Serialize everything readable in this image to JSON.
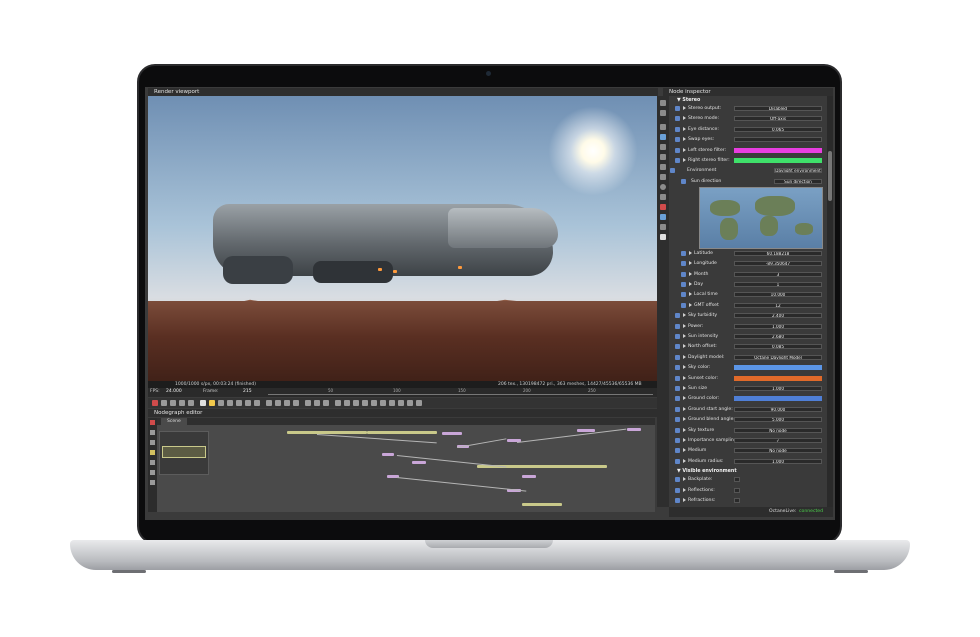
{
  "viewport": {
    "title": "Render viewport",
    "status_left": "1000/1000 s/px, 00:03:24 (finished)",
    "status_right": "206 tex., 130198472 pri., 363 meshes, 14427/45536/65536 MB",
    "timeline_ticks": [
      "50",
      "100",
      "150",
      "200",
      "250"
    ],
    "fps_label": "FPS:",
    "fps_value": "24.000",
    "frame_label": "Frame:",
    "frame_value": "215"
  },
  "nodegraph": {
    "title": "Nodegraph editor",
    "tab": "Scene"
  },
  "inspector": {
    "title": "Node inspector",
    "stereo_section": "Stereo",
    "stereo": [
      {
        "label": "Stereo output:",
        "value": "Disabled"
      },
      {
        "label": "Stereo mode:",
        "value": "Off-axis"
      },
      {
        "label": "Eye distance:",
        "value": "0.065"
      },
      {
        "label": "Swap eyes:",
        "value": ""
      },
      {
        "label": "Left stereo filter:",
        "swatch": "#e83ee0"
      },
      {
        "label": "Right stereo filter:",
        "swatch": "#3fe06a"
      }
    ],
    "environment_label": "Environment",
    "environment_value": "Daylight environment",
    "sun_direction_label": "Sun direction",
    "sun_direction_value": "Sun direction",
    "sun_params": [
      {
        "label": "Latitude",
        "value": "60.188218"
      },
      {
        "label": "Longitude",
        "value": "-89.350647"
      },
      {
        "label": "Month",
        "value": "3"
      },
      {
        "label": "Day",
        "value": "1"
      },
      {
        "label": "Local time",
        "value": "10.000"
      },
      {
        "label": "GMT offset",
        "value": "12"
      }
    ],
    "env_params": [
      {
        "label": "Sky turbidity",
        "value": "2.400"
      },
      {
        "label": "Power:",
        "value": "1.000"
      },
      {
        "label": "Sun intensity",
        "value": "2.680"
      },
      {
        "label": "North offset:",
        "value": "0.085"
      },
      {
        "label": "Daylight model:",
        "value": "Octane Daylight Model"
      },
      {
        "label": "Sky color:",
        "swatch": "#5b95e6"
      },
      {
        "label": "Sunset color:",
        "swatch": "#e06a2a"
      },
      {
        "label": "Sun size",
        "value": "1.000"
      },
      {
        "label": "Ground color:",
        "swatch": "#4f7fd6"
      },
      {
        "label": "Ground start angle:",
        "value": "90.000"
      },
      {
        "label": "Ground blend angle:",
        "value": "5.000"
      },
      {
        "label": "Sky texture",
        "value": "No node"
      },
      {
        "label": "Importance sampling:",
        "value": "✓"
      },
      {
        "label": "Medium",
        "value": "No node"
      },
      {
        "label": "Medium radius:",
        "value": "1.000"
      }
    ],
    "visible_env_section": "Visible environment",
    "visible_env": [
      {
        "label": "Backplate:"
      },
      {
        "label": "Reflections:"
      },
      {
        "label": "Refractions:"
      }
    ]
  },
  "status": {
    "label": "OctaneLive:",
    "value": "connected",
    "value_color": "#4cd04c"
  }
}
